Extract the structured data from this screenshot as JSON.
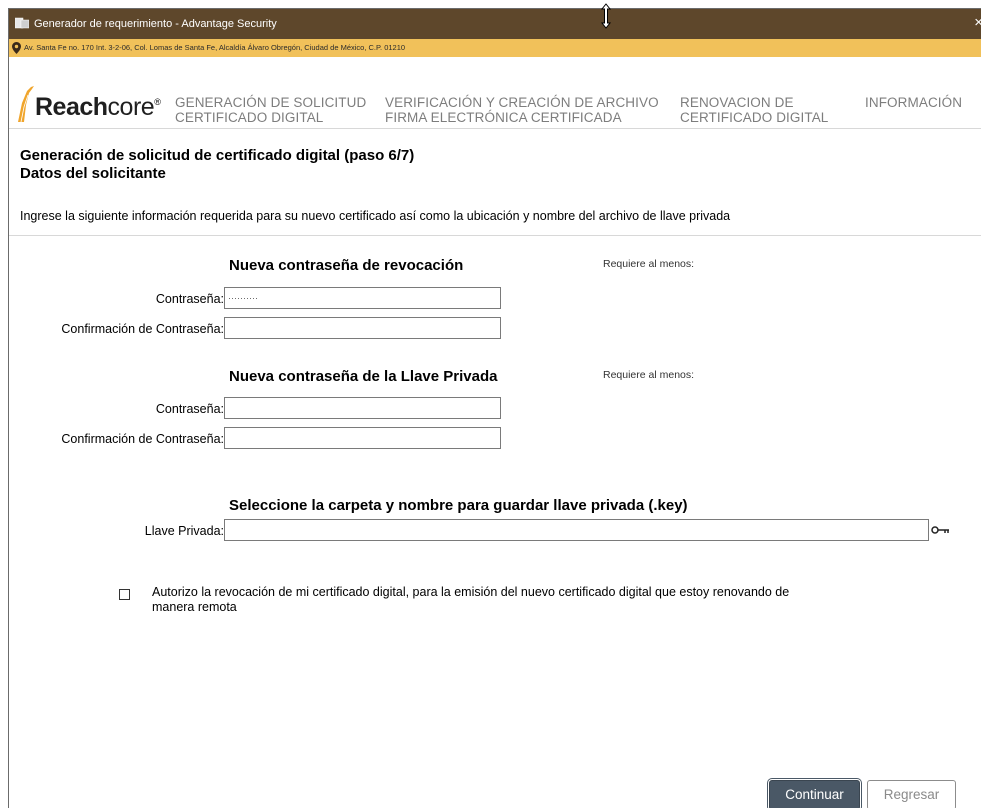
{
  "window": {
    "title": "Generador de requerimiento - Advantage Security",
    "close_glyph": "×",
    "address": "Av. Santa Fe no. 170 Int. 3-2-06, Col. Lomas de Santa Fe, Alcaldía Álvaro Obregón, Ciudad de México, C.P. 01210"
  },
  "logo": {
    "brand_bold": "Reach",
    "brand_regular": "core",
    "reg_mark": "®"
  },
  "nav": {
    "items": [
      {
        "line1": "GENERACIÓN DE SOLICITUD",
        "line2": "CERTIFICADO DIGITAL"
      },
      {
        "line1": "VERIFICACIÓN Y CREACIÓN DE ARCHIVO",
        "line2": "FIRMA ELECTRÓNICA CERTIFICADA"
      },
      {
        "line1": "RENOVACION DE",
        "line2": "CERTIFICADO DIGITAL"
      },
      {
        "line1": "INFORMACIÓN",
        "line2": ""
      }
    ]
  },
  "page": {
    "title": "Generación de solicitud de certificado digital (paso 6/7)",
    "subtitle": "Datos del solicitante",
    "intro": "Ingrese la siguiente información requerida para su nuevo certificado así como la ubicación y nombre del archivo de llave privada"
  },
  "revocation": {
    "title": "Nueva contraseña de revocación",
    "requirement": "Requiere al menos:",
    "password_label": "Contraseña:",
    "password_value": "··········",
    "confirm_label": "Confirmación de Contraseña:",
    "confirm_value": ""
  },
  "private_key": {
    "title": "Nueva contraseña de la Llave Privada",
    "requirement": "Requiere al menos:",
    "password_label": "Contraseña:",
    "password_value": "",
    "confirm_label": "Confirmación de Contraseña:",
    "confirm_value": ""
  },
  "key_file": {
    "title": "Seleccione la carpeta y nombre para guardar llave privada (.key)",
    "label": "Llave Privada:",
    "value": ""
  },
  "authorization": {
    "checked": false,
    "text": "Autorizo la revocación de mi certificado digital, para la emisión del nuevo certificado digital que estoy renovando de manera remota"
  },
  "buttons": {
    "continue": "Continuar",
    "back": "Regresar"
  },
  "colors": {
    "titlebar": "#5e472b",
    "addressbar": "#f1c15a",
    "nav_text": "#7d7d7d",
    "primary_button": "#4a5866"
  }
}
